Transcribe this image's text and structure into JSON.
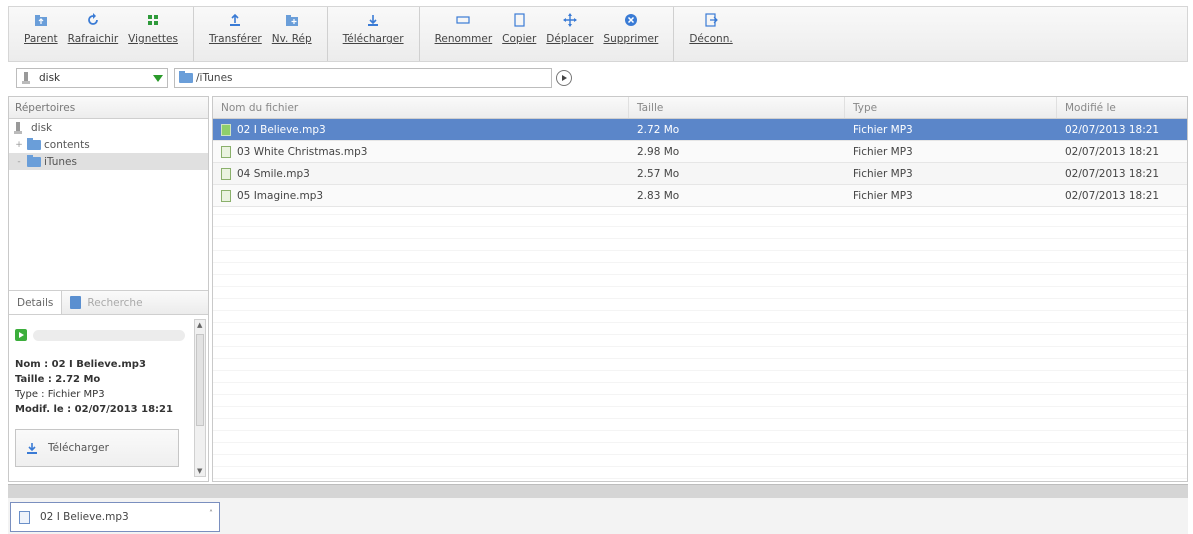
{
  "toolbar": {
    "groups": [
      [
        {
          "name": "parent-button",
          "icon": "folder-up-icon",
          "label": "Parent"
        },
        {
          "name": "refresh-button",
          "icon": "refresh-icon",
          "label": "Rafraichir"
        },
        {
          "name": "thumbnails-button",
          "icon": "grid-icon",
          "label": "Vignettes"
        }
      ],
      [
        {
          "name": "upload-button",
          "icon": "upload-icon",
          "label": "Transférer"
        },
        {
          "name": "new-folder-button",
          "icon": "new-folder-icon",
          "label": "Nv. Rép"
        }
      ],
      [
        {
          "name": "download-button",
          "icon": "download-icon",
          "label": "Télécharger"
        }
      ],
      [
        {
          "name": "rename-button",
          "icon": "rename-icon",
          "label": "Renommer"
        },
        {
          "name": "copy-button",
          "icon": "copy-icon",
          "label": "Copier"
        },
        {
          "name": "move-button",
          "icon": "move-icon",
          "label": "Déplacer"
        },
        {
          "name": "delete-button",
          "icon": "delete-icon",
          "label": "Supprimer"
        }
      ],
      [
        {
          "name": "logout-button",
          "icon": "logout-icon",
          "label": "Déconn."
        }
      ]
    ]
  },
  "address": {
    "drive": "disk",
    "path": "/iTunes"
  },
  "left_panel": {
    "header": "Répertoires",
    "tree": [
      {
        "label": "disk",
        "level": 0,
        "type": "drive"
      },
      {
        "label": "contents",
        "level": 1,
        "type": "folder"
      },
      {
        "label": "iTunes",
        "level": 1,
        "type": "folder",
        "selected": true
      }
    ],
    "tabs": {
      "details": "Details",
      "search": "Recherche"
    },
    "details": {
      "name_line": "Nom : 02 I Believe.mp3",
      "size_line": "Taille : 2.72 Mo",
      "type_line": "Type : Fichier MP3",
      "modified_line": "Modif. le : 02/07/2013 18:21",
      "download_label": "Télécharger"
    }
  },
  "file_list": {
    "columns": [
      "Nom du fichier",
      "Taille",
      "Type",
      "Modifié le"
    ],
    "rows": [
      [
        "02 I Believe.mp3",
        "2.72 Mo",
        "Fichier MP3",
        "02/07/2013 18:21"
      ],
      [
        "03 White Christmas.mp3",
        "2.98 Mo",
        "Fichier MP3",
        "02/07/2013 18:21"
      ],
      [
        "04 Smile.mp3",
        "2.57 Mo",
        "Fichier MP3",
        "02/07/2013 18:21"
      ],
      [
        "05 Imagine.mp3",
        "2.83 Mo",
        "Fichier MP3",
        "02/07/2013 18:21"
      ]
    ],
    "selected_index": 0
  },
  "downloads_bar": {
    "item": "02 I Believe.mp3"
  },
  "colors": {
    "selection": "#5b86c9",
    "folder": "#6a9ed9",
    "play": "#3cae3c"
  }
}
